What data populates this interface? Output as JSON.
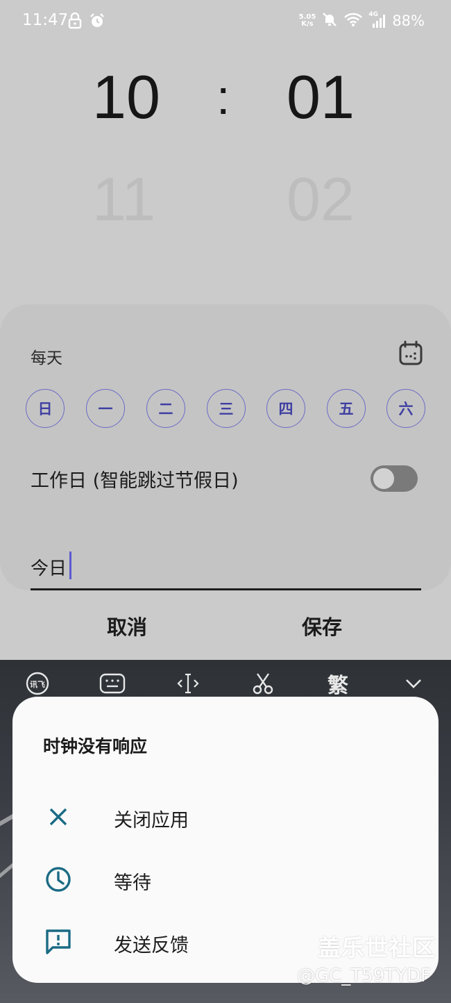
{
  "status_bar": {
    "time": "11:47",
    "net_speed_value": "5.05",
    "net_speed_unit": "K/s",
    "signal_label": "4G",
    "battery": "88%",
    "icons": [
      "lock-icon",
      "alarm-icon",
      "mute-icon",
      "wifi-icon",
      "signal-icon"
    ]
  },
  "time_picker": {
    "hour_current": "10",
    "minute_current": "01",
    "separator": ":",
    "hour_next": "11",
    "minute_next": "02"
  },
  "repeat": {
    "label": "每天",
    "calendar_icon": "calendar-icon",
    "days": [
      "日",
      "一",
      "二",
      "三",
      "四",
      "五",
      "六"
    ]
  },
  "workday": {
    "label": "工作日 (智能跳过节假日)",
    "enabled": false
  },
  "alarm_name": {
    "value": "今日"
  },
  "actions": {
    "cancel": "取消",
    "save": "保存"
  },
  "keyboard_toolbar": {
    "items": [
      "voice-input-icon",
      "keyboard-icon",
      "cursor-move-icon",
      "scissors-icon",
      "繁",
      "chevron-down-icon"
    ]
  },
  "dialog": {
    "title": "时钟没有响应",
    "items": [
      {
        "icon": "close-icon",
        "label": "关闭应用"
      },
      {
        "icon": "clock-icon",
        "label": "等待"
      },
      {
        "icon": "feedback-icon",
        "label": "发送反馈"
      }
    ],
    "accent_color": "#1b6b84"
  },
  "watermark": {
    "brand": "盖乐世社区",
    "user": "@GC_T59TYDF"
  }
}
